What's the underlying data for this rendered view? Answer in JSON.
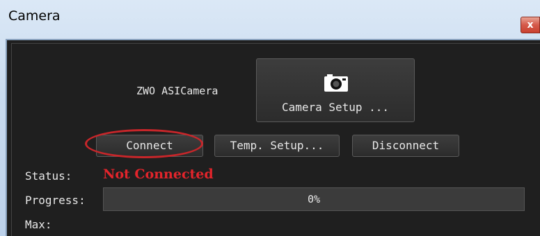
{
  "window": {
    "title": "Camera",
    "close_glyph": "x"
  },
  "camera": {
    "name": "ZWO ASICamera",
    "setup_label": "Camera Setup ...",
    "icon": "camera-icon"
  },
  "buttons": {
    "connect": "Connect",
    "temp_setup": "Temp. Setup...",
    "disconnect": "Disconnect"
  },
  "status": {
    "label": "Status:",
    "value": "Not Connected",
    "color": "#e3242b"
  },
  "progress": {
    "label": "Progress:",
    "value": 0,
    "text": "0%"
  },
  "max": {
    "label": "Max:"
  },
  "annotation": {
    "highlight_color": "#c8262a"
  }
}
